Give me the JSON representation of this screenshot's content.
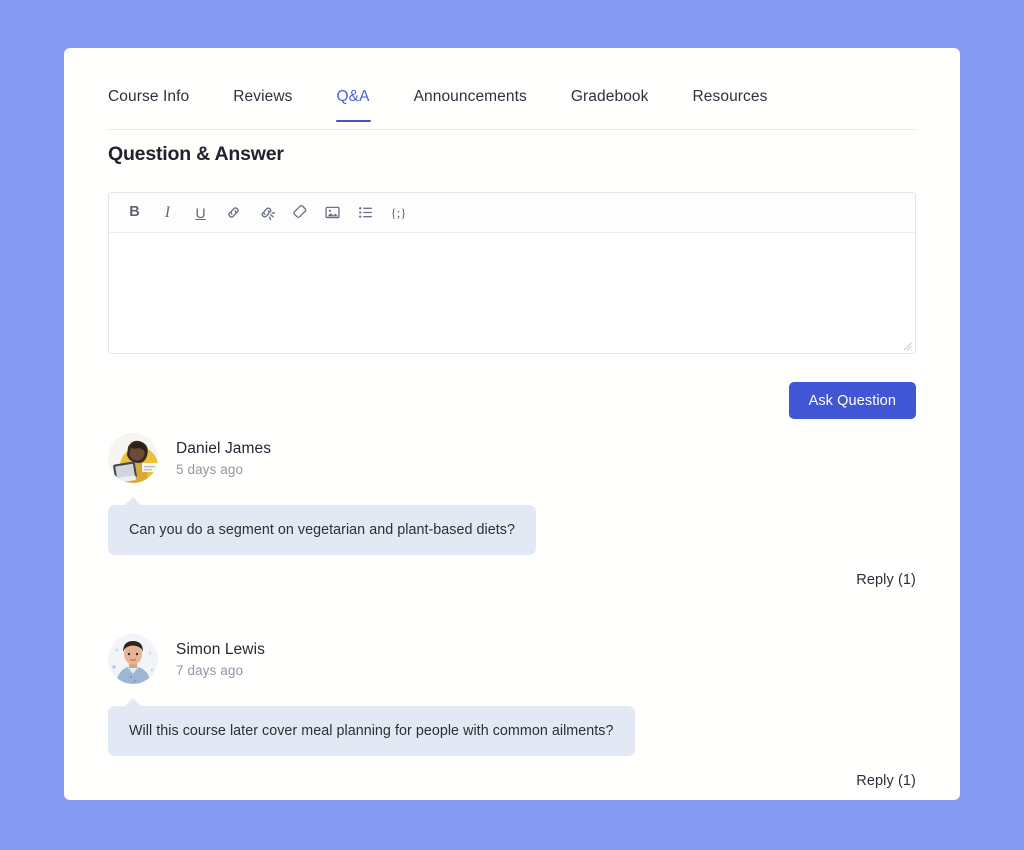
{
  "theme": {
    "page_background": "#859bf3",
    "card_background": "#fffffe",
    "accent": "#4056d4",
    "active_tab_color": "#4a63d8",
    "bubble_background": "#e2e8f4",
    "muted_text": "#9096a4"
  },
  "tabs": [
    {
      "label": "Course Info",
      "active": false,
      "name": "tab-course-info"
    },
    {
      "label": "Reviews",
      "active": false,
      "name": "tab-reviews"
    },
    {
      "label": "Q&A",
      "active": true,
      "name": "tab-qa"
    },
    {
      "label": "Announcements",
      "active": false,
      "name": "tab-announcements"
    },
    {
      "label": "Gradebook",
      "active": false,
      "name": "tab-gradebook"
    },
    {
      "label": "Resources",
      "active": false,
      "name": "tab-resources"
    }
  ],
  "section": {
    "title": "Question & Answer"
  },
  "editor": {
    "value": "",
    "placeholder": "",
    "toolbar": [
      {
        "icon": "bold-icon",
        "label": "B",
        "kind": "text",
        "style": "bold"
      },
      {
        "icon": "italic-icon",
        "label": "I",
        "kind": "text",
        "style": "ital"
      },
      {
        "icon": "underline-icon",
        "label": "U",
        "kind": "text",
        "style": "undr"
      },
      {
        "icon": "link-icon",
        "label": "",
        "kind": "svg-link"
      },
      {
        "icon": "unlink-icon",
        "label": "",
        "kind": "svg-unlink"
      },
      {
        "icon": "eraser-icon",
        "label": "",
        "kind": "svg-eraser"
      },
      {
        "icon": "image-icon",
        "label": "",
        "kind": "svg-image"
      },
      {
        "icon": "bulleted-list-icon",
        "label": "",
        "kind": "svg-list"
      },
      {
        "icon": "code-block-icon",
        "label": "{;}",
        "kind": "text",
        "style": "code"
      }
    ],
    "resize_handle_icon": "resize-handle-icon"
  },
  "actions": {
    "ask_question_label": "Ask Question"
  },
  "comments": [
    {
      "author": "Daniel James",
      "time": "5 days ago",
      "text": "Can you do a segment on vegetarian and plant-based diets?",
      "reply_label": "Reply (1)",
      "avatar": "avatar-daniel-james"
    },
    {
      "author": "Simon Lewis",
      "time": "7 days ago",
      "text": "Will this course later cover meal planning for people with common ailments?",
      "reply_label": "Reply (1)",
      "avatar": "avatar-simon-lewis"
    }
  ]
}
